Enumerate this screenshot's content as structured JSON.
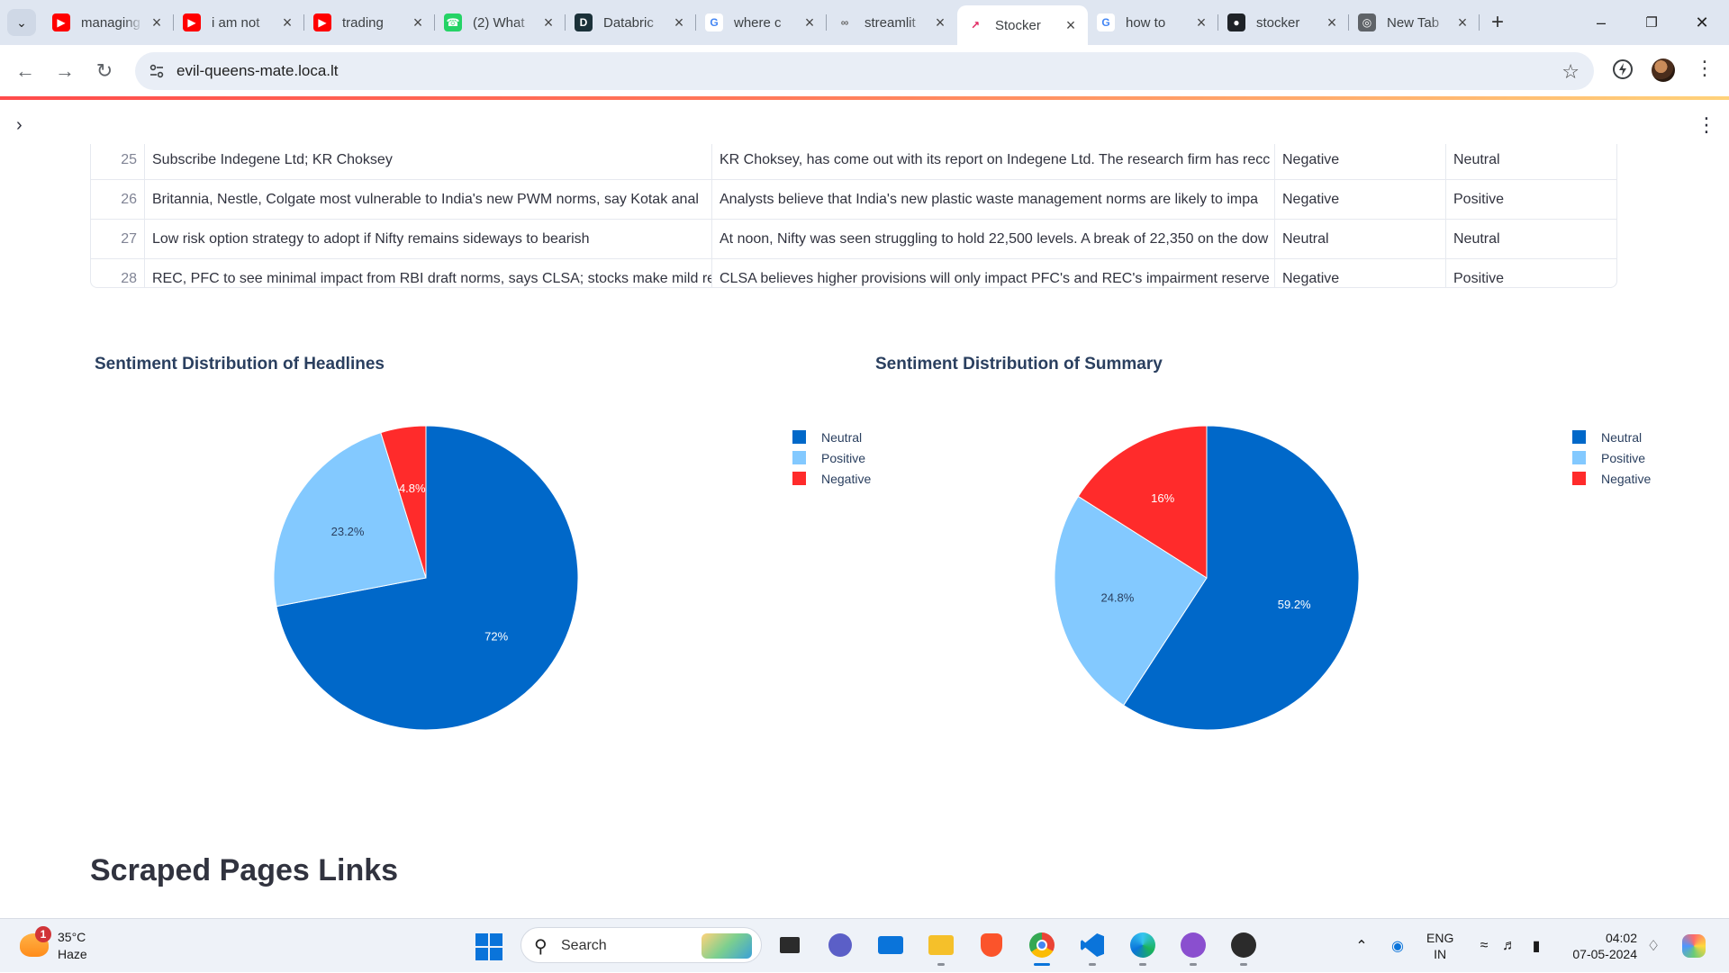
{
  "browser": {
    "tabs": [
      {
        "title": "managing",
        "favicon": "youtube-icon"
      },
      {
        "title": "i am not",
        "favicon": "youtube-icon"
      },
      {
        "title": "trading",
        "favicon": "youtube-icon"
      },
      {
        "title": "(2) What",
        "favicon": "whatsapp-icon"
      },
      {
        "title": "Databric",
        "favicon": "databricks-icon"
      },
      {
        "title": "where c",
        "favicon": "google-icon"
      },
      {
        "title": "streamlit",
        "favicon": "streamlit-icon"
      },
      {
        "title": "Stocker",
        "favicon": "stocker-icon",
        "active": true
      },
      {
        "title": "how to",
        "favicon": "google-icon"
      },
      {
        "title": "stocker",
        "favicon": "github-icon"
      },
      {
        "title": "New Tab",
        "favicon": "chrome-icon"
      }
    ],
    "url": "evil-queens-mate.loca.lt"
  },
  "table": {
    "rows": [
      {
        "index": "25",
        "headline": "Subscribe Indegene Ltd; KR Choksey",
        "summary": "KR Choksey, has come out with its report on Indegene Ltd. The research firm has recc",
        "headline_sentiment": "Negative",
        "summary_sentiment": "Neutral"
      },
      {
        "index": "26",
        "headline": "Britannia, Nestle, Colgate most vulnerable to India's new PWM norms, say Kotak anal",
        "summary": "Analysts believe that India's new plastic waste management norms are likely to impa",
        "headline_sentiment": "Negative",
        "summary_sentiment": "Positive"
      },
      {
        "index": "27",
        "headline": "Low risk option strategy to adopt if Nifty remains sideways to bearish",
        "summary": "At noon, Nifty was seen struggling to hold 22,500 levels. A break of 22,350 on the dow",
        "headline_sentiment": "Neutral",
        "summary_sentiment": "Neutral"
      },
      {
        "index": "28",
        "headline": "REC, PFC to see minimal impact from RBI draft norms, says CLSA; stocks make mild re",
        "summary": "CLSA believes higher provisions will only impact PFC's and REC's impairment reserve",
        "headline_sentiment": "Negative",
        "summary_sentiment": "Positive"
      }
    ]
  },
  "chart_data": [
    {
      "type": "pie",
      "title": "Sentiment Distribution of Headlines",
      "labels": [
        "Neutral",
        "Positive",
        "Negative"
      ],
      "values": [
        72,
        23.2,
        4.8
      ],
      "value_labels": [
        "72%",
        "23.2%",
        "4.8%"
      ],
      "colors": [
        "#0068c9",
        "#83c9ff",
        "#ff2b2b"
      ],
      "legend": "right"
    },
    {
      "type": "pie",
      "title": "Sentiment Distribution of Summary",
      "labels": [
        "Neutral",
        "Positive",
        "Negative"
      ],
      "values": [
        59.2,
        24.8,
        16
      ],
      "value_labels": [
        "59.2%",
        "24.8%",
        "16%"
      ],
      "colors": [
        "#0068c9",
        "#83c9ff",
        "#ff2b2b"
      ],
      "legend": "right"
    }
  ],
  "section_heading": "Scraped Pages Links",
  "taskbar": {
    "weather_temp": "35°C",
    "weather_desc": "Haze",
    "weather_badge": "1",
    "search_label": "Search",
    "lang_line1": "ENG",
    "lang_line2": "IN",
    "time": "04:02",
    "date": "07-05-2024"
  }
}
